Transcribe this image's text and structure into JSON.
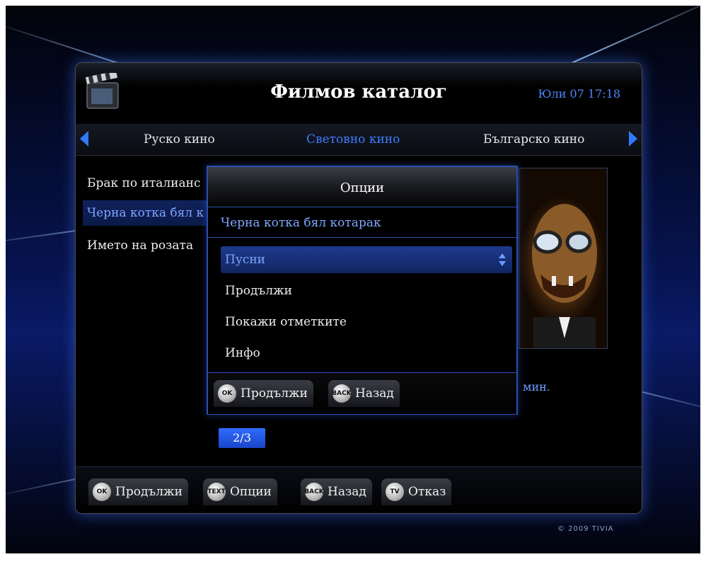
{
  "header": {
    "title": "Филмов каталог",
    "datetime": "Юли 07 17:18",
    "logo_icon": "film-clapper-icon"
  },
  "tabs": [
    {
      "label": "Руско кино",
      "active": false
    },
    {
      "label": "Световно кино",
      "active": true
    },
    {
      "label": "Българско кино",
      "active": false
    }
  ],
  "movies": [
    {
      "label": "Брак по италианс",
      "selected": false
    },
    {
      "label": "Черна котка бял к",
      "selected": true
    },
    {
      "label": "Името на розата",
      "selected": false
    }
  ],
  "details": {
    "duration_unit": "мин."
  },
  "pagination": {
    "indicator": "2/3"
  },
  "dialog": {
    "title": "Опции",
    "subtitle": "Черна котка бял котарак",
    "options": [
      {
        "label": "Пусни",
        "selected": true
      },
      {
        "label": "Продължи",
        "selected": false
      },
      {
        "label": "Покажи отметките",
        "selected": false
      },
      {
        "label": "Инфо",
        "selected": false
      }
    ],
    "footer": [
      {
        "key": "OK",
        "label": "Продължи"
      },
      {
        "key": "BACK",
        "label": "Назад"
      }
    ]
  },
  "footer": {
    "hints": [
      {
        "key": "OK",
        "label": "Продължи"
      },
      {
        "key": "TEXT",
        "label": "Опции"
      },
      {
        "key": "BACK",
        "label": "Назад"
      },
      {
        "key": "TV",
        "label": "Отказ"
      }
    ]
  },
  "copyright": "© 2009 TIVIA",
  "colors": {
    "accent": "#3f7cff",
    "panel_bg": "#000000",
    "background": "#0a1a66"
  }
}
